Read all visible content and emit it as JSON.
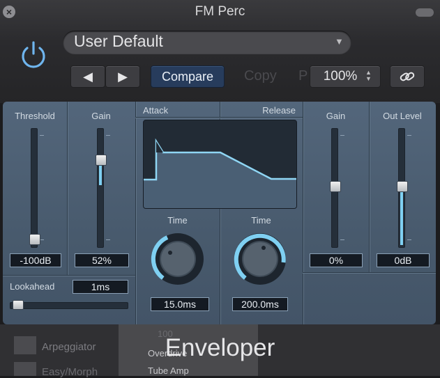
{
  "window": {
    "title": "FM Perc",
    "close_icon": "close-icon"
  },
  "header": {
    "preset": "User Default",
    "compare": "Compare",
    "copy": "Copy",
    "paste": "P",
    "zoom": "100%",
    "prev_icon": "prev-arrow-icon",
    "next_icon": "next-arrow-icon",
    "link_icon": "link-icon",
    "power_icon": "power-icon"
  },
  "plugin": {
    "name": "Enveloper",
    "threshold": {
      "label": "Threshold",
      "value": "-100dB",
      "level": 0.0
    },
    "gain_in": {
      "label": "Gain",
      "value": "52%",
      "level": 0.52
    },
    "lookahead": {
      "label": "Lookahead",
      "value": "1ms",
      "level": 0.05
    },
    "attack": {
      "label": "Attack",
      "time_label": "Time",
      "time_value": "15.0ms",
      "level": 0.45
    },
    "release": {
      "label": "Release",
      "time_label": "Time",
      "time_value": "200.0ms",
      "level": 0.7
    },
    "gain_out": {
      "label": "Gain",
      "value": "0%",
      "level": 0.5
    },
    "out_level": {
      "label": "Out Level",
      "value": "0dB",
      "level": 0.5
    }
  },
  "background": {
    "arpeggiator": "Arpeggiator",
    "easy_morph": "Easy/Morph",
    "overdrive": "Overdrive",
    "tube_amp": "Tube Amp",
    "value": "100"
  },
  "colors": {
    "accent": "#7fd0f2",
    "panel": "#4d6075",
    "compare_bg": "#273c5c"
  }
}
